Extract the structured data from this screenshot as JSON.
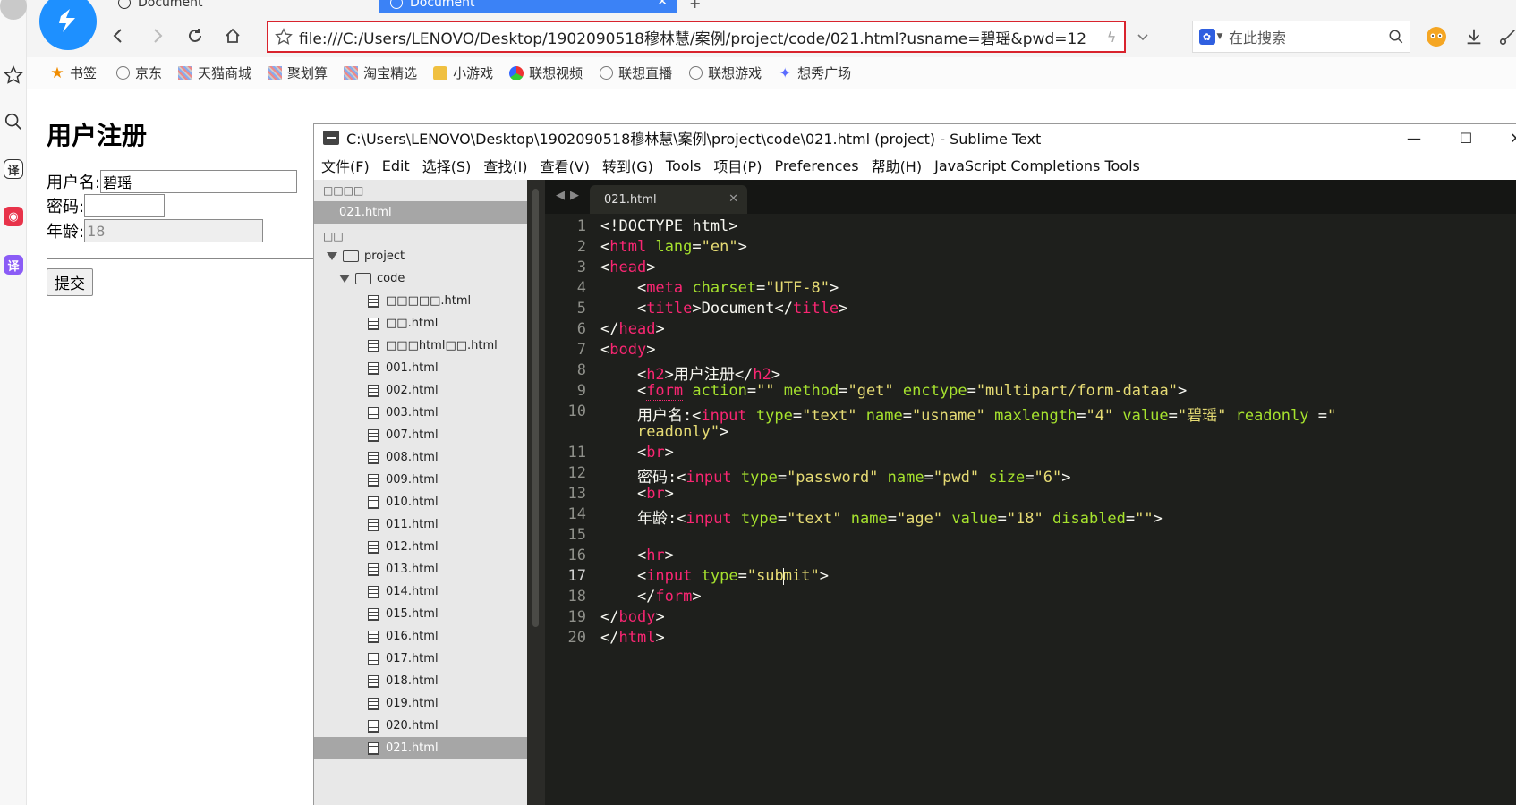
{
  "browser": {
    "tabs": [
      {
        "label": "Document",
        "active": false
      },
      {
        "label": "Document",
        "active": true
      }
    ],
    "url": "file:///C:/Users/LENOVO/Desktop/1902090518穆林慧/案例/project/code/021.html?usname=碧瑶&pwd=12",
    "search_placeholder": "在此搜索",
    "bookmarks": [
      {
        "label": "书签",
        "icon": "star-icon"
      },
      {
        "label": "京东",
        "icon": "globe-icon"
      },
      {
        "label": "天猫商城",
        "icon": "site-icon"
      },
      {
        "label": "聚划算",
        "icon": "site-icon"
      },
      {
        "label": "淘宝精选",
        "icon": "site-icon"
      },
      {
        "label": "小游戏",
        "icon": "game-icon"
      },
      {
        "label": "联想视频",
        "icon": "video-icon"
      },
      {
        "label": "联想直播",
        "icon": "globe-icon"
      },
      {
        "label": "联想游戏",
        "icon": "globe-icon"
      },
      {
        "label": "想秀广场",
        "icon": "sparkle-icon"
      }
    ],
    "rail": {
      "translate_label": "译"
    }
  },
  "page": {
    "heading": "用户注册",
    "username_label": "用户名:",
    "username_value": "碧瑶",
    "password_label": "密码:",
    "age_label": "年龄:",
    "age_value": "18",
    "submit_label": "提交"
  },
  "sublime": {
    "title": "C:\\Users\\LENOVO\\Desktop\\1902090518穆林慧\\案例\\project\\code\\021.html (project) - Sublime Text",
    "menu": [
      "文件(F)",
      "Edit",
      "选择(S)",
      "查找(I)",
      "查看(V)",
      "转到(G)",
      "Tools",
      "项目(P)",
      "Preferences",
      "帮助(H)",
      "JavaScript Completions Tools"
    ],
    "sidebar": {
      "open_files_header": "□□□□",
      "open_file": "021.html",
      "folders_header": "□□",
      "project_folder": "project",
      "code_folder": "code",
      "files": [
        "□□□□□.html",
        "□□.html",
        "□□□html□□.html",
        "001.html",
        "002.html",
        "003.html",
        "007.html",
        "008.html",
        "009.html",
        "010.html",
        "011.html",
        "012.html",
        "013.html",
        "014.html",
        "015.html",
        "016.html",
        "017.html",
        "018.html",
        "019.html",
        "020.html",
        "021.html"
      ]
    },
    "active_tab": "021.html",
    "line_numbers": [
      "1",
      "2",
      "3",
      "4",
      "5",
      "6",
      "7",
      "8",
      "9",
      "10",
      "",
      "11",
      "12",
      "13",
      "14",
      "15",
      "16",
      "17",
      "18",
      "19",
      "20"
    ],
    "current_line": "17"
  }
}
